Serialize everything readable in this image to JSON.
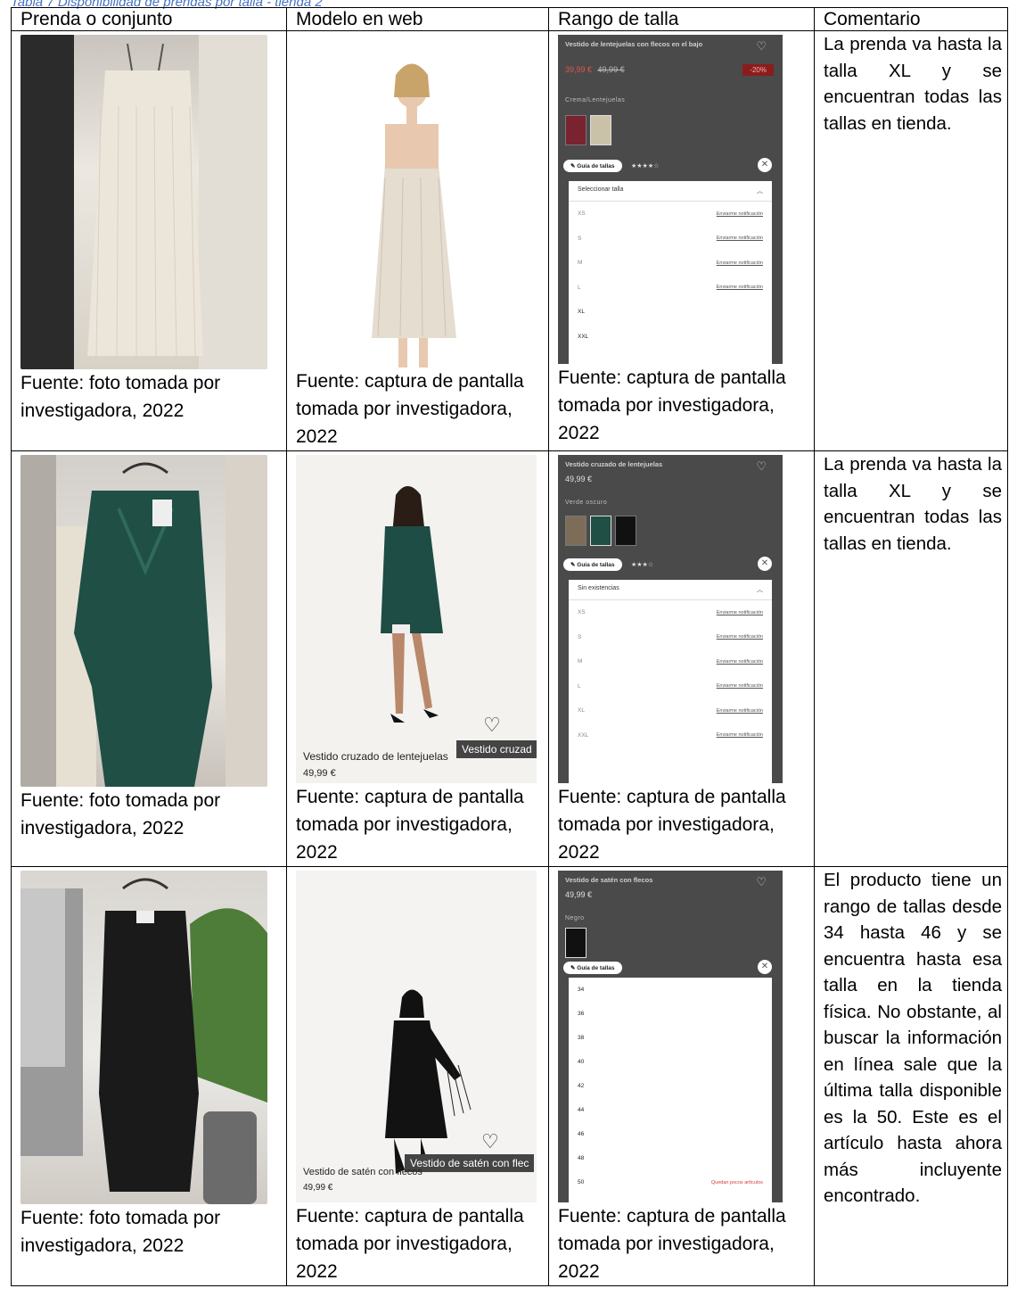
{
  "caption": "Tabla 7 Disponibilidad de prendas por talla - tienda 2",
  "headers": [
    "Prenda o conjunto",
    "Modelo en web",
    "Rango de talla",
    "Comentario"
  ],
  "source_photo": "Fuente: foto tomada por investigadora, 2022",
  "source_capture": "Fuente: captura de pantalla tomada por investigadora, 2022",
  "rows": [
    {
      "comment": "La prenda va hasta la talla XL y se encuentran todas las tallas en tienda.",
      "shop": {
        "title": "Vestido de lentejuelas con flecos en el bajo",
        "price": "39,99 €",
        "old_price": "49,99 €",
        "badge": "-20%",
        "color": "Crema/Lentejuelas",
        "guide": "Guía de tallas",
        "panel_head": "Seleccionar talla",
        "sizes": [
          {
            "size": "XS",
            "note": "Enviarme notificación"
          },
          {
            "size": "S",
            "note": "Enviarme notificación"
          },
          {
            "size": "M",
            "note": "Enviarme notificación"
          },
          {
            "size": "L",
            "note": "Enviarme notificación"
          },
          {
            "size": "XL",
            "note": ""
          },
          {
            "size": "XXL",
            "note": ""
          }
        ]
      },
      "model": {
        "caption": "",
        "price": "",
        "tooltip": ""
      }
    },
    {
      "comment": "La prenda va hasta la talla XL y se encuentran todas las tallas en tienda.",
      "shop": {
        "title": "Vestido cruzado de lentejuelas",
        "price": "49,99 €",
        "color": "Verde oscuro",
        "guide": "Guía de tallas",
        "panel_head": "Sin existencias",
        "sizes": [
          {
            "size": "XS",
            "note": "Enviarme notificación"
          },
          {
            "size": "S",
            "note": "Enviarme notificación"
          },
          {
            "size": "M",
            "note": "Enviarme notificación"
          },
          {
            "size": "L",
            "note": "Enviarme notificación"
          },
          {
            "size": "XL",
            "note": "Enviarme notificación"
          },
          {
            "size": "XXL",
            "note": "Enviarme notificación"
          }
        ]
      },
      "model": {
        "caption": "Vestido cruzado de lentejuelas",
        "price": "49,99 €",
        "tooltip": "Vestido cruzad"
      }
    },
    {
      "comment": "El producto tiene un rango de tallas desde 34 hasta 46 y se encuentra hasta esa talla en la tienda física. No obstante, al buscar la información en línea sale que la última talla disponible es la 50. Este es el artículo hasta ahora más incluyente encontrado.",
      "shop": {
        "title": "Vestido de satén con flecos",
        "price": "49,99 €",
        "color": "Negro",
        "guide": "Guía de tallas",
        "sizes": [
          {
            "size": "34",
            "note": ""
          },
          {
            "size": "36",
            "note": ""
          },
          {
            "size": "38",
            "note": ""
          },
          {
            "size": "40",
            "note": ""
          },
          {
            "size": "42",
            "note": ""
          },
          {
            "size": "44",
            "note": ""
          },
          {
            "size": "46",
            "note": ""
          },
          {
            "size": "48",
            "note": ""
          },
          {
            "size": "50",
            "note": "Quedan pocos artículos"
          }
        ]
      },
      "model": {
        "caption": "Vestido de satén con flecos",
        "price": "49,99 €",
        "tooltip": "Vestido de satén con flec"
      }
    }
  ]
}
